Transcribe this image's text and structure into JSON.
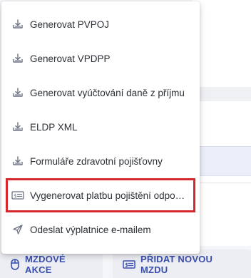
{
  "menu": {
    "items": [
      {
        "label": "Generovat PVPOJ",
        "icon": "download-tray-icon"
      },
      {
        "label": "Generovat VPDPP",
        "icon": "download-tray-icon"
      },
      {
        "label": "Generovat vyúčtování daně z příjmu",
        "icon": "download-tray-icon"
      },
      {
        "label": "ELDP XML",
        "icon": "download-tray-icon"
      },
      {
        "label": "Formuláře zdravotní pojišťovny",
        "icon": "download-tray-icon"
      },
      {
        "label": "Vygenerovat platbu pojištění odpo…",
        "icon": "money-note-icon",
        "highlighted": true
      },
      {
        "label": "Odeslat výplatnice e-mailem",
        "icon": "send-icon"
      }
    ]
  },
  "actions": {
    "mzdove_akce": "MZDOVÉ AKCE",
    "pridat_mzdu": "PŘIDAT NOVOU MZDU"
  },
  "colors": {
    "accent": "#3a4fb0",
    "highlight_border": "#d7262c",
    "menu_text": "#2b2f36",
    "icon": "#6b7280"
  }
}
